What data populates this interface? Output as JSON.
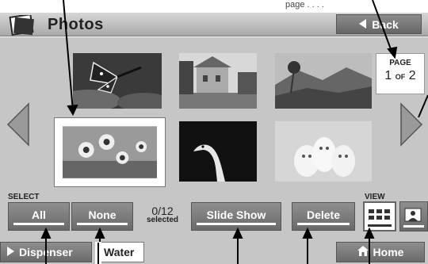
{
  "header": {
    "title": "Photos",
    "back_label": "Back",
    "caption": "page . . . ."
  },
  "page": {
    "label": "PAGE",
    "current": "1",
    "of": "OF",
    "total": "2"
  },
  "select": {
    "label": "SELECT",
    "all_label": "All",
    "none_label": "None",
    "count": "0/12",
    "selected_text": "selected"
  },
  "actions": {
    "slideshow_label": "Slide Show",
    "delete_label": "Delete"
  },
  "view": {
    "label": "VIEW"
  },
  "footer": {
    "dispenser_label": "Dispenser",
    "water_label": "Water",
    "home_label": "Home"
  },
  "photos": [
    {
      "subject": "monarch butterfly on flowers"
    },
    {
      "subject": "village street with houses"
    },
    {
      "subject": "tropical landscape"
    },
    {
      "subject": "sunflowers",
      "selected": true
    },
    {
      "subject": "swan head"
    },
    {
      "subject": "three puppies"
    }
  ],
  "colors": {
    "button": "#7a7a7a",
    "content_bg": "#c6c6c6",
    "text_dark": "#222222"
  }
}
